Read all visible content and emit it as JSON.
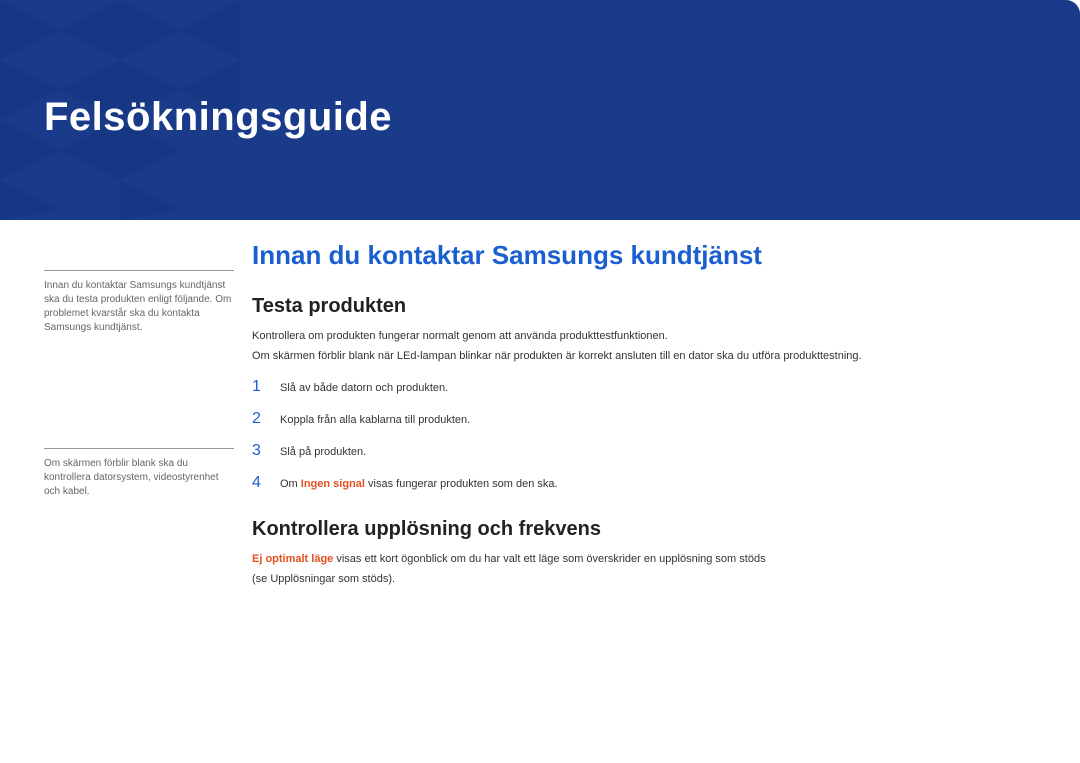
{
  "banner": {
    "title": "Felsökningsguide"
  },
  "sidebar": {
    "note1": "Innan du kontaktar Samsungs kundtjänst ska du testa produkten enligt följande. Om problemet kvarstår ska du kontakta Samsungs kundtjänst.",
    "note2": "Om skärmen förblir blank ska du kontrollera datorsystem, videostyrenhet och kabel."
  },
  "main": {
    "heading": "Innan du kontaktar Samsungs kundtjänst",
    "section1": {
      "title": "Testa produkten",
      "p1": "Kontrollera om produkten fungerar normalt genom att använda produkttestfunktionen.",
      "p2": "Om skärmen förblir blank när LEd-lampan blinkar när produkten är korrekt ansluten till en dator ska du utföra produkttestning.",
      "steps": [
        "Slå av både datorn och produkten.",
        "Koppla från alla kablarna till produkten.",
        "Slå på produkten."
      ],
      "step4_prefix": "Om ",
      "step4_highlight": "Ingen signal",
      "step4_suffix": " visas fungerar produkten som den ska."
    },
    "section2": {
      "title": "Kontrollera upplösning och frekvens",
      "p1_highlight": "Ej optimalt läge",
      "p1_suffix": " visas ett kort ögonblick om du har valt ett läge som överskrider en upplösning som stöds",
      "p2": "(se Upplösningar som stöds)."
    }
  }
}
